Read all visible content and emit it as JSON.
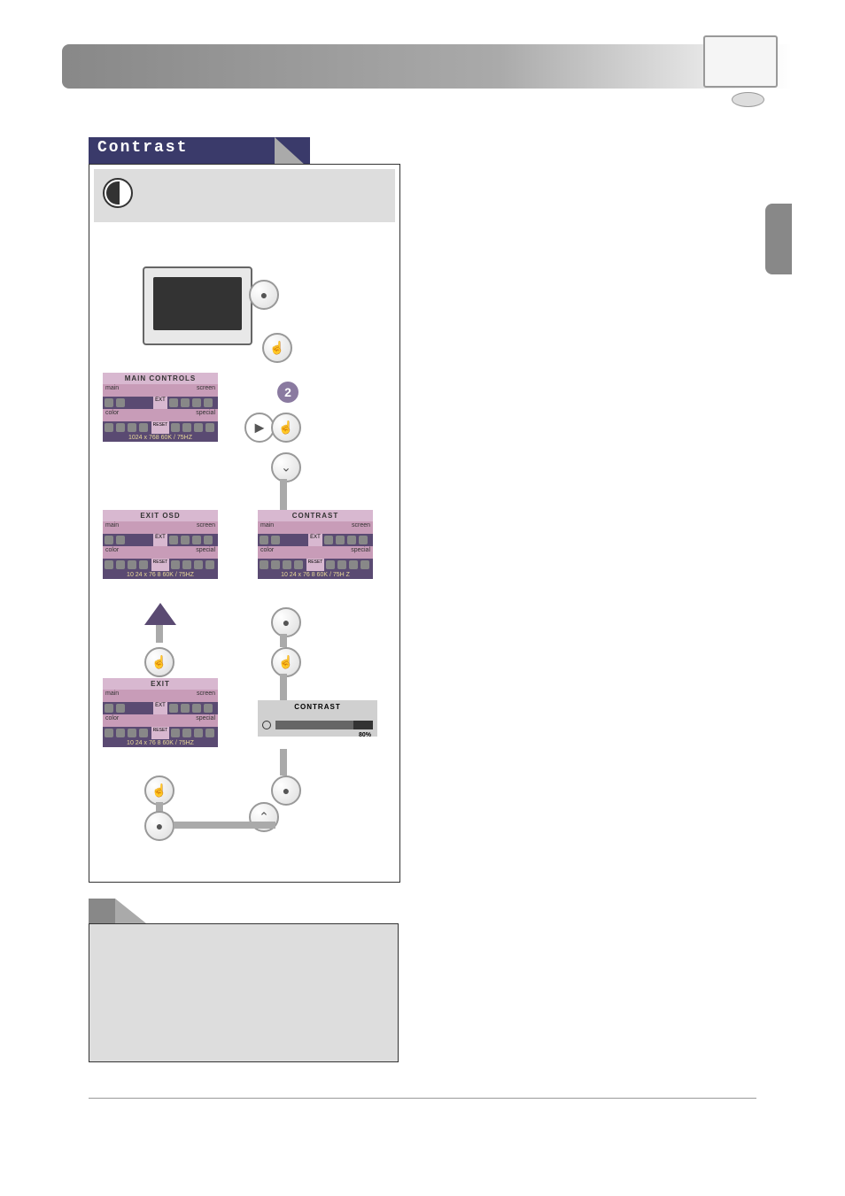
{
  "section_title": "Contrast",
  "monitor_osd": {
    "main_controls": {
      "title": "MAIN CONTROLS",
      "row1_left": "main",
      "row1_right": "screen",
      "center1": "EXT",
      "row2_left": "color",
      "row2_right": "special",
      "center2": "RESET",
      "status": "1024 x 768   60K / 75HZ"
    },
    "exit_osd": {
      "title": "EXIT OSD",
      "row1_left": "main",
      "row1_right": "screen",
      "center1": "EXT",
      "row2_left": "color",
      "row2_right": "special",
      "center2": "RESET",
      "status": "10 24 x 76 8   60K / 75HZ"
    },
    "exit": {
      "title": "EXIT",
      "row1_left": "main",
      "row1_right": "screen",
      "center1": "EXT",
      "row2_left": "color",
      "row2_right": "special",
      "center2": "RESET",
      "status": "10 24 x 76 8   60K / 75HZ"
    },
    "contrast_panel": {
      "title": "CONTRAST",
      "row1_left": "main",
      "row1_right": "screen",
      "center1": "EXT",
      "row2_left": "color",
      "row2_right": "special",
      "center2": "RESET",
      "status": "10 24 x 76 8   60K / 75H Z"
    }
  },
  "contrast_slider": {
    "title": "CONTRAST",
    "value_pct": "80%"
  },
  "chart_data": {
    "type": "bar",
    "categories": [
      "Contrast"
    ],
    "values": [
      80
    ],
    "title": "CONTRAST",
    "ylabel": "",
    "xlabel": "",
    "ylim": [
      0,
      100
    ]
  },
  "step_badge": "2"
}
